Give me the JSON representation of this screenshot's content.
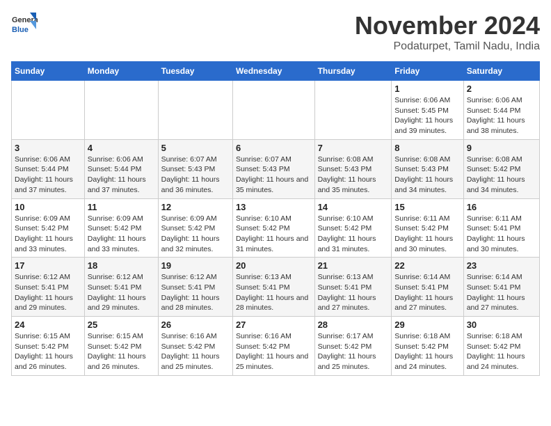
{
  "logo": {
    "general": "General",
    "blue": "Blue"
  },
  "title": "November 2024",
  "location": "Podaturpet, Tamil Nadu, India",
  "weekdays": [
    "Sunday",
    "Monday",
    "Tuesday",
    "Wednesday",
    "Thursday",
    "Friday",
    "Saturday"
  ],
  "weeks": [
    [
      {
        "day": "",
        "info": ""
      },
      {
        "day": "",
        "info": ""
      },
      {
        "day": "",
        "info": ""
      },
      {
        "day": "",
        "info": ""
      },
      {
        "day": "",
        "info": ""
      },
      {
        "day": "1",
        "info": "Sunrise: 6:06 AM\nSunset: 5:45 PM\nDaylight: 11 hours and 39 minutes."
      },
      {
        "day": "2",
        "info": "Sunrise: 6:06 AM\nSunset: 5:44 PM\nDaylight: 11 hours and 38 minutes."
      }
    ],
    [
      {
        "day": "3",
        "info": "Sunrise: 6:06 AM\nSunset: 5:44 PM\nDaylight: 11 hours and 37 minutes."
      },
      {
        "day": "4",
        "info": "Sunrise: 6:06 AM\nSunset: 5:44 PM\nDaylight: 11 hours and 37 minutes."
      },
      {
        "day": "5",
        "info": "Sunrise: 6:07 AM\nSunset: 5:43 PM\nDaylight: 11 hours and 36 minutes."
      },
      {
        "day": "6",
        "info": "Sunrise: 6:07 AM\nSunset: 5:43 PM\nDaylight: 11 hours and 35 minutes."
      },
      {
        "day": "7",
        "info": "Sunrise: 6:08 AM\nSunset: 5:43 PM\nDaylight: 11 hours and 35 minutes."
      },
      {
        "day": "8",
        "info": "Sunrise: 6:08 AM\nSunset: 5:43 PM\nDaylight: 11 hours and 34 minutes."
      },
      {
        "day": "9",
        "info": "Sunrise: 6:08 AM\nSunset: 5:42 PM\nDaylight: 11 hours and 34 minutes."
      }
    ],
    [
      {
        "day": "10",
        "info": "Sunrise: 6:09 AM\nSunset: 5:42 PM\nDaylight: 11 hours and 33 minutes."
      },
      {
        "day": "11",
        "info": "Sunrise: 6:09 AM\nSunset: 5:42 PM\nDaylight: 11 hours and 33 minutes."
      },
      {
        "day": "12",
        "info": "Sunrise: 6:09 AM\nSunset: 5:42 PM\nDaylight: 11 hours and 32 minutes."
      },
      {
        "day": "13",
        "info": "Sunrise: 6:10 AM\nSunset: 5:42 PM\nDaylight: 11 hours and 31 minutes."
      },
      {
        "day": "14",
        "info": "Sunrise: 6:10 AM\nSunset: 5:42 PM\nDaylight: 11 hours and 31 minutes."
      },
      {
        "day": "15",
        "info": "Sunrise: 6:11 AM\nSunset: 5:42 PM\nDaylight: 11 hours and 30 minutes."
      },
      {
        "day": "16",
        "info": "Sunrise: 6:11 AM\nSunset: 5:41 PM\nDaylight: 11 hours and 30 minutes."
      }
    ],
    [
      {
        "day": "17",
        "info": "Sunrise: 6:12 AM\nSunset: 5:41 PM\nDaylight: 11 hours and 29 minutes."
      },
      {
        "day": "18",
        "info": "Sunrise: 6:12 AM\nSunset: 5:41 PM\nDaylight: 11 hours and 29 minutes."
      },
      {
        "day": "19",
        "info": "Sunrise: 6:12 AM\nSunset: 5:41 PM\nDaylight: 11 hours and 28 minutes."
      },
      {
        "day": "20",
        "info": "Sunrise: 6:13 AM\nSunset: 5:41 PM\nDaylight: 11 hours and 28 minutes."
      },
      {
        "day": "21",
        "info": "Sunrise: 6:13 AM\nSunset: 5:41 PM\nDaylight: 11 hours and 27 minutes."
      },
      {
        "day": "22",
        "info": "Sunrise: 6:14 AM\nSunset: 5:41 PM\nDaylight: 11 hours and 27 minutes."
      },
      {
        "day": "23",
        "info": "Sunrise: 6:14 AM\nSunset: 5:41 PM\nDaylight: 11 hours and 27 minutes."
      }
    ],
    [
      {
        "day": "24",
        "info": "Sunrise: 6:15 AM\nSunset: 5:42 PM\nDaylight: 11 hours and 26 minutes."
      },
      {
        "day": "25",
        "info": "Sunrise: 6:15 AM\nSunset: 5:42 PM\nDaylight: 11 hours and 26 minutes."
      },
      {
        "day": "26",
        "info": "Sunrise: 6:16 AM\nSunset: 5:42 PM\nDaylight: 11 hours and 25 minutes."
      },
      {
        "day": "27",
        "info": "Sunrise: 6:16 AM\nSunset: 5:42 PM\nDaylight: 11 hours and 25 minutes."
      },
      {
        "day": "28",
        "info": "Sunrise: 6:17 AM\nSunset: 5:42 PM\nDaylight: 11 hours and 25 minutes."
      },
      {
        "day": "29",
        "info": "Sunrise: 6:18 AM\nSunset: 5:42 PM\nDaylight: 11 hours and 24 minutes."
      },
      {
        "day": "30",
        "info": "Sunrise: 6:18 AM\nSunset: 5:42 PM\nDaylight: 11 hours and 24 minutes."
      }
    ]
  ]
}
